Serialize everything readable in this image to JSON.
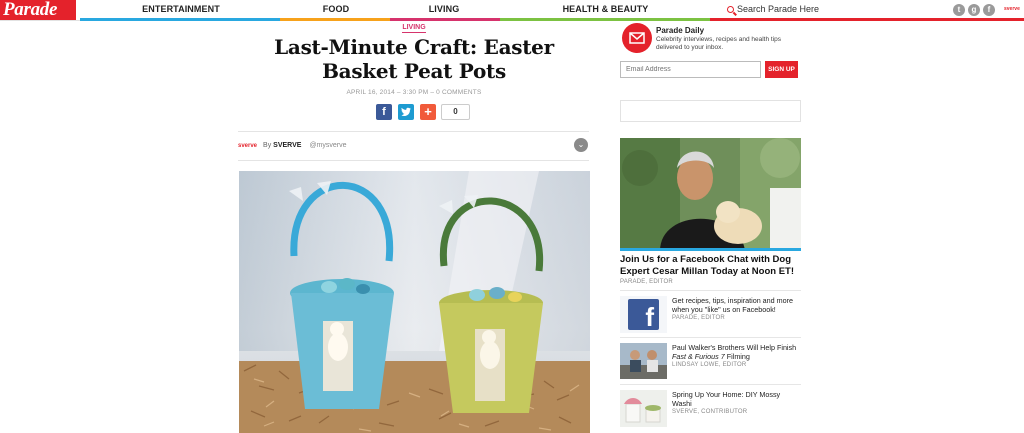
{
  "brand": {
    "logo": "Parade"
  },
  "nav": {
    "items": [
      {
        "label": "ENTERTAINMENT",
        "color": "#29a8e0"
      },
      {
        "label": "FOOD",
        "color": "#f7a21b"
      },
      {
        "label": "LIVING",
        "color": "#d6336c"
      },
      {
        "label": "HEALTH & BEAUTY",
        "color": "#7cc242"
      }
    ],
    "search_placeholder": "Search Parade Here",
    "social": [
      "twitter-icon",
      "google-plus-icon",
      "facebook-icon"
    ],
    "sverve_tag": "sverve"
  },
  "article": {
    "category": "LIVING",
    "title": "Last-Minute Craft: Easter Basket Peat Pots",
    "meta": "APRIL 16, 2014 – 3:30 PM – 0 COMMENTS",
    "share_count": "0",
    "byline": {
      "source": "sverve",
      "prefix": "By",
      "author": "SVERVE",
      "handle": "@mysverve"
    }
  },
  "sidebar": {
    "newsletter": {
      "title": "Parade Daily",
      "description": "Celebrity interviews, recipes and health tips delivered to your inbox.",
      "email_placeholder": "Email Address",
      "signup_label": "SIGN UP"
    },
    "promo": {
      "title": "Join Us for a Facebook Chat with Dog Expert Cesar Millan Today at Noon ET!",
      "byline": "PARADE, EDITOR"
    },
    "items": [
      {
        "title": "Get recipes, tips, inspiration and more when you \"like\" us on Facebook!",
        "byline": "PARADE, EDITOR"
      },
      {
        "title_pre": "Paul Walker's Brothers Will Help Finish ",
        "title_em": "Fast & Furious 7",
        "title_post": " Filming",
        "byline": "LINDSAY LOWE, EDITOR"
      },
      {
        "title": "Spring Up Your Home: DIY Mossy Washi",
        "byline": "SVERVE, CONTRIBUTOR"
      }
    ]
  },
  "colors": {
    "brand_red": "#e4222b",
    "living_pink": "#d6336c",
    "facebook_blue": "#3b5998",
    "twitter_blue": "#1d9bd1"
  }
}
